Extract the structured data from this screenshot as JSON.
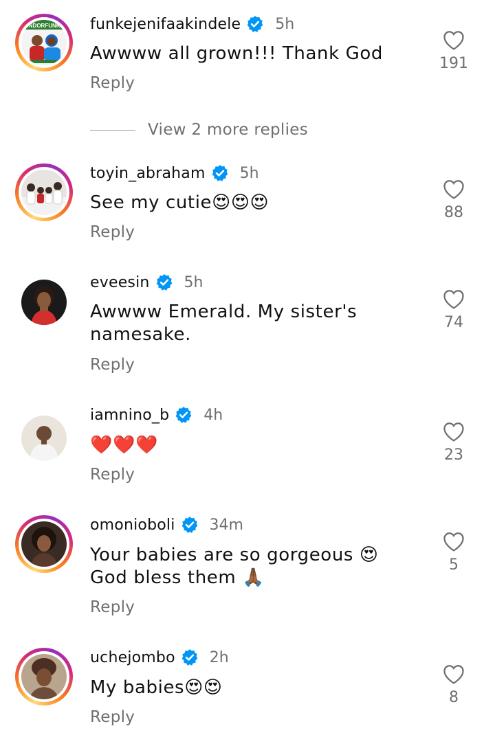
{
  "comments": [
    {
      "username": "funkejenifaakindele",
      "time": "5h",
      "text": "Awwww all grown!!! Thank God",
      "reply": "Reply",
      "likes": "191",
      "avatar_text": "JINDORFUNKE"
    },
    {
      "username": "toyin_abraham",
      "time": "5h",
      "text": "See my cutie😍😍😍",
      "reply": "Reply",
      "likes": "88"
    },
    {
      "username": "eveesin",
      "time": "5h",
      "text": "Awwww Emerald. My sister's namesake.",
      "reply": "Reply",
      "likes": "74"
    },
    {
      "username": "iamnino_b",
      "time": "4h",
      "text": "❤️❤️❤️",
      "reply": "Reply",
      "likes": "23"
    },
    {
      "username": "omonioboli",
      "time": "34m",
      "text": "Your babies are so gorgeous 😍 God bless them 🙏🏾",
      "reply": "Reply",
      "likes": "5"
    },
    {
      "username": "uchejombo",
      "time": "2h",
      "text": "My babies😍😍",
      "reply": "Reply",
      "likes": "8"
    }
  ],
  "view_more": "View 2 more replies",
  "colors": {
    "verified": "#0095f6",
    "secondary_text": "#6f6f6f",
    "primary_text": "#111111"
  }
}
